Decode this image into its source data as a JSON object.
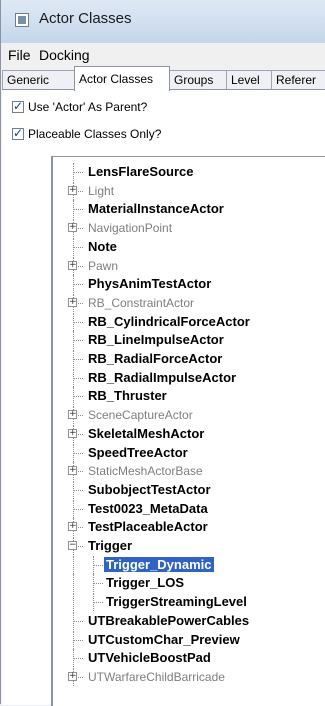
{
  "window": {
    "title": "Actor Classes"
  },
  "menu": [
    {
      "label": "File"
    },
    {
      "label": "Docking"
    }
  ],
  "tabs": [
    {
      "label": "Generic"
    },
    {
      "label": "Actor Classes"
    },
    {
      "label": "Groups"
    },
    {
      "label": "Level"
    },
    {
      "label": "Referer"
    }
  ],
  "options": {
    "use_actor_parent": {
      "label": "Use 'Actor' As Parent?",
      "checked": true
    },
    "placeable_only": {
      "label": "Placeable Classes Only?",
      "checked": true
    }
  },
  "tree": [
    {
      "label": "LensFlareSource",
      "style": "bold",
      "expander": ""
    },
    {
      "label": "Light",
      "style": "faded",
      "expander": "+"
    },
    {
      "label": "MaterialInstanceActor",
      "style": "bold",
      "expander": ""
    },
    {
      "label": "NavigationPoint",
      "style": "faded",
      "expander": "+"
    },
    {
      "label": "Note",
      "style": "bold",
      "expander": ""
    },
    {
      "label": "Pawn",
      "style": "faded",
      "expander": "+"
    },
    {
      "label": "PhysAnimTestActor",
      "style": "bold",
      "expander": ""
    },
    {
      "label": "RB_ConstraintActor",
      "style": "faded",
      "expander": "+"
    },
    {
      "label": "RB_CylindricalForceActor",
      "style": "bold",
      "expander": ""
    },
    {
      "label": "RB_LineImpulseActor",
      "style": "bold",
      "expander": ""
    },
    {
      "label": "RB_RadialForceActor",
      "style": "bold",
      "expander": ""
    },
    {
      "label": "RB_RadialImpulseActor",
      "style": "bold",
      "expander": ""
    },
    {
      "label": "RB_Thruster",
      "style": "bold",
      "expander": ""
    },
    {
      "label": "SceneCaptureActor",
      "style": "faded",
      "expander": "+"
    },
    {
      "label": "SkeletalMeshActor",
      "style": "bold",
      "expander": "+"
    },
    {
      "label": "SpeedTreeActor",
      "style": "bold",
      "expander": ""
    },
    {
      "label": "StaticMeshActorBase",
      "style": "faded",
      "expander": "+"
    },
    {
      "label": "SubobjectTestActor",
      "style": "bold",
      "expander": ""
    },
    {
      "label": "Test0023_MetaData",
      "style": "bold",
      "expander": ""
    },
    {
      "label": "TestPlaceableActor",
      "style": "bold",
      "expander": "+"
    },
    {
      "label": "Trigger",
      "style": "bold",
      "expander": "−"
    },
    {
      "label": "Trigger_Dynamic",
      "style": "bold",
      "expander": "",
      "child": true,
      "selected": true
    },
    {
      "label": "Trigger_LOS",
      "style": "bold",
      "expander": "",
      "child": true
    },
    {
      "label": "TriggerStreamingLevel",
      "style": "bold",
      "expander": "",
      "child": true
    },
    {
      "label": "UTBreakablePowerCables",
      "style": "bold",
      "expander": ""
    },
    {
      "label": "UTCustomChar_Preview",
      "style": "bold",
      "expander": ""
    },
    {
      "label": "UTVehicleBoostPad",
      "style": "bold",
      "expander": ""
    },
    {
      "label": "UTWarfareChildBarricade",
      "style": "faded",
      "expander": "+"
    }
  ],
  "colors": {
    "selection": "#2f64c4",
    "faded_text": "#7e7e7e"
  }
}
